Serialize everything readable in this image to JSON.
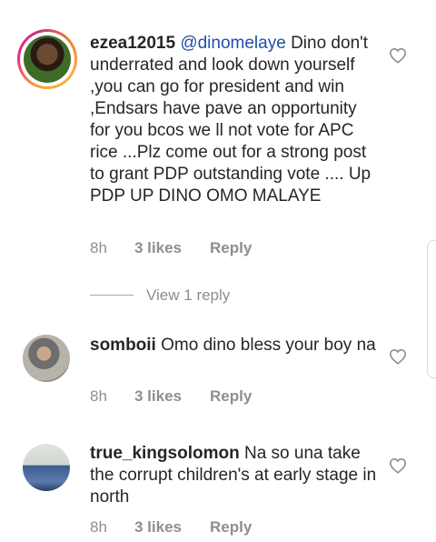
{
  "comments": [
    {
      "username": "ezea12015",
      "mention": "@dinomelaye",
      "text": "Dino don't underrated and look down yourself ,you can go for president and win ,Endsars have pave an opportunity for you bcos we ll not vote for APC rice ...Plz come out for a strong post to grant PDP outstanding vote .... Up PDP UP DINO OMO MALAYE",
      "time": "8h",
      "likes": "3 likes",
      "reply_label": "Reply",
      "view_replies": "View 1 reply"
    },
    {
      "username": "somboii",
      "text": "Omo dino bless your boy na",
      "time": "8h",
      "likes": "3 likes",
      "reply_label": "Reply"
    },
    {
      "username": "true_kingsolomon",
      "text": "Na so una take the corrupt children's at early stage in north",
      "time": "8h",
      "likes": "3 likes",
      "reply_label": "Reply"
    }
  ],
  "icons": {
    "like": "heart-outline-icon",
    "story_ring": "story-ring"
  },
  "colors": {
    "text": "#262626",
    "muted": "#8e8e8e",
    "mention": "#1e4fa8"
  }
}
